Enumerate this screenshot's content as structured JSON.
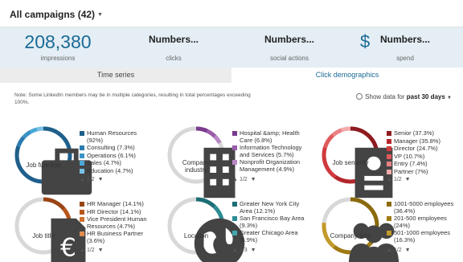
{
  "header": {
    "title": "All campaigns (42)"
  },
  "stats": [
    {
      "value": "208,380",
      "label": "impressions"
    },
    {
      "value": "Numbers...",
      "label": "clicks"
    },
    {
      "value": "Numbers...",
      "label": "social actions"
    },
    {
      "value": "Numbers...",
      "label": "spend",
      "symbol": "$"
    }
  ],
  "tabs": [
    {
      "label": "Time series",
      "active": false
    },
    {
      "label": "Click demographics",
      "active": true
    }
  ],
  "note": "Note: Some LinkedIn members may be in multiple categories, resulting in total percentages exceeding 100%.",
  "filter": {
    "prefix": "Show data for",
    "value": "past 30 days"
  },
  "cards": [
    {
      "label": "Job function",
      "icon": "briefcase-icon",
      "color": "#1f5f8b",
      "pager": "1/2",
      "items": [
        {
          "label": "Human Resources (92%)",
          "color": "#1f5f8b",
          "value": 92
        },
        {
          "label": "Consulting (7.3%)",
          "color": "#2b7bb0",
          "value": 7.3
        },
        {
          "label": "Operations (6.1%)",
          "color": "#3a93c6",
          "value": 6.1
        },
        {
          "label": "Sales (4.7%)",
          "color": "#4ba9d8",
          "value": 4.7
        },
        {
          "label": "Education (4.7%)",
          "color": "#78c2e6",
          "value": 4.7
        }
      ]
    },
    {
      "label": "Company industry",
      "icon": "building-icon",
      "color": "#7a3b8f",
      "pager": "1/2",
      "items": [
        {
          "label": "Hospital &amp; Health Care (6.8%)",
          "color": "#7a3b8f",
          "value": 6.8
        },
        {
          "label": "Information Technology and Services (5.7%)",
          "color": "#9a5cab",
          "value": 5.7
        },
        {
          "label": "Nonprofit Organization Management (4.9%)",
          "color": "#b887c6",
          "value": 4.9
        }
      ]
    },
    {
      "label": "Job seniority",
      "icon": "id-card-icon",
      "color": "#b5262b",
      "pager": "1/2",
      "items": [
        {
          "label": "Senior (37.3%)",
          "color": "#8e1b20",
          "value": 37.3
        },
        {
          "label": "Manager (35.8%)",
          "color": "#b5262b",
          "value": 35.8
        },
        {
          "label": "Director (24.7%)",
          "color": "#d0393d",
          "value": 24.7
        },
        {
          "label": "VP (10.7%)",
          "color": "#e05a5c",
          "value": 10.7
        },
        {
          "label": "Entry (7.4%)",
          "color": "#ea8284",
          "value": 7.4
        },
        {
          "label": "Partner (7%)",
          "color": "#f2aaab",
          "value": 7
        }
      ]
    },
    {
      "label": "Job title",
      "icon": "document-euro-icon",
      "color": "#b8561a",
      "pager": "1/2",
      "items": [
        {
          "label": "HR Manager (14.1%)",
          "color": "#9a4514",
          "value": 14.1
        },
        {
          "label": "HR Director (14.1%)",
          "color": "#b8561a",
          "value": 14.1
        },
        {
          "label": "Vice President Human Resources (4.7%)",
          "color": "#cf6f2f",
          "value": 4.7
        },
        {
          "label": "HR Business Partner (3.6%)",
          "color": "#e08c50",
          "value": 3.6
        }
      ]
    },
    {
      "label": "Location",
      "icon": "globe-icon",
      "color": "#1d6e75",
      "pager": "1/3",
      "items": [
        {
          "label": "Greater New York City Area (12.1%)",
          "color": "#1d6e75",
          "value": 12.1
        },
        {
          "label": "San Francisco Bay Area (9.3%)",
          "color": "#2b8c93",
          "value": 9.3
        },
        {
          "label": "Greater Chicago Area (5.9%)",
          "color": "#45a7ad",
          "value": 5.9
        }
      ]
    },
    {
      "label": "Company size",
      "icon": "people-icon",
      "color": "#a07a12",
      "pager": "1/2",
      "items": [
        {
          "label": "1001-5000 employees (36.4%)",
          "color": "#8a6a0e",
          "value": 36.4
        },
        {
          "label": "201-500 employees (24%)",
          "color": "#a07a12",
          "value": 24
        },
        {
          "label": "501-1000 employees (16.3%)",
          "color": "#c39a2a",
          "value": 16.3
        }
      ]
    }
  ]
}
